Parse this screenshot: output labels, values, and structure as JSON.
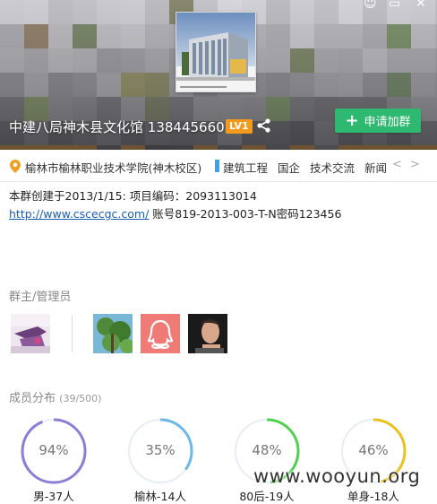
{
  "header": {
    "group_name": "中建八局神木县文化馆 138445660",
    "level_badge": "LV1",
    "join_button_label": "申请加群",
    "join_button_color": "#2eb870",
    "window_controls": [
      "☺",
      "▭",
      "✕"
    ]
  },
  "tagbar": {
    "location": "榆林市榆林职业技术学院(神木校区)",
    "tags": [
      "建筑工程",
      "国企",
      "技术交流",
      "新闻"
    ],
    "prev_arrow": "<",
    "next_arrow": ">"
  },
  "description": {
    "line1": "本群创建于2013/1/15:  项目编码：2093113014",
    "link": "http://www.cscecgc.com/",
    "line2_rest": " 账号819-2013-003-T-N密码123456"
  },
  "admins": {
    "title": "群主/管理员",
    "avatars": [
      "owner-avatar",
      "admin-avatar-tree",
      "admin-avatar-penguin",
      "admin-avatar-person"
    ]
  },
  "distribution": {
    "title": "成员分布",
    "count": "(39/500)",
    "stats": [
      {
        "percent": "94%",
        "value": 0.94,
        "label": "男-37人",
        "color": "#8e7cd6"
      },
      {
        "percent": "35%",
        "value": 0.35,
        "label": "榆林-14人",
        "color": "#6bb8ea"
      },
      {
        "percent": "48%",
        "value": 0.48,
        "label": "80后-19人",
        "color": "#4fd04f"
      },
      {
        "percent": "46%",
        "value": 0.46,
        "label": "单身-18人",
        "color": "#e8c21a"
      }
    ]
  },
  "watermark": "www.wooyun.org"
}
